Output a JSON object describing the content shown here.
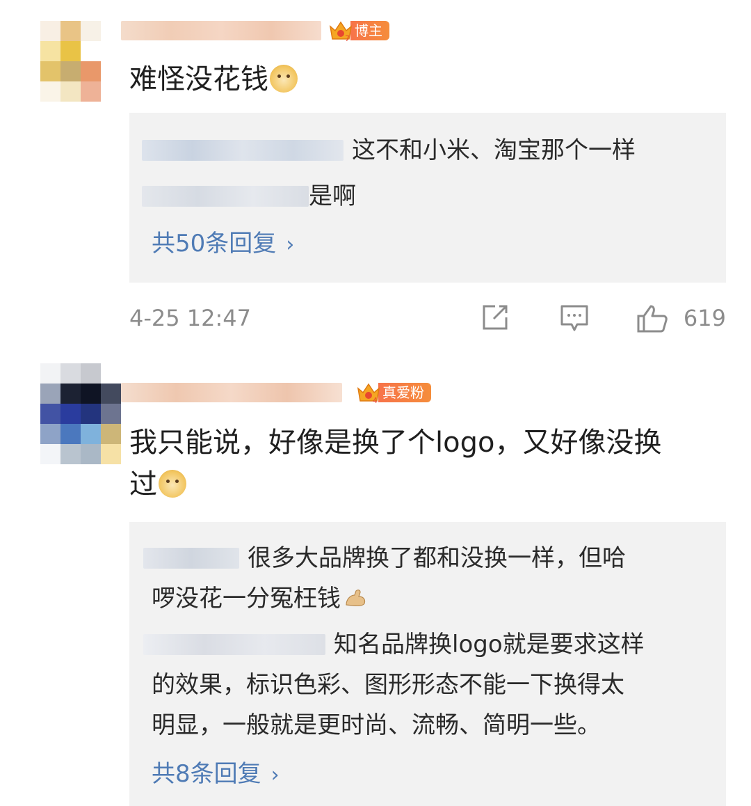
{
  "comments": [
    {
      "badge": "博主",
      "badge_level": "7",
      "text": "难怪没花钱",
      "emoji": "doge-emoji",
      "replies": [
        {
          "text": "这不和小米、淘宝那个一样"
        },
        {
          "text": "是啊"
        }
      ],
      "more_replies": "共50条回复",
      "time": "4-25 12:47",
      "likes": "619",
      "actions": [
        "share-icon",
        "comment-icon",
        "like-icon"
      ]
    },
    {
      "badge": "真爱粉",
      "badge_level": "4",
      "text_line1": "我只能说，好像是换了个logo，又好像没换",
      "text_line2": "过",
      "emoji": "doge-emoji",
      "replies": [
        {
          "line1": "很多大品牌换了都和没换一样，但哈",
          "line2": "啰没花一分冤枉钱",
          "emoji": "flex-arm-emoji"
        },
        {
          "line1": "知名品牌换logo就是要求这样",
          "line2": "的效果，标识色彩、图形形态不能一下换得太",
          "line3": "明显，一般就是更时尚、流畅、简明一些。"
        }
      ],
      "more_replies": "共8条回复"
    }
  ],
  "colors": {
    "link": "#4f7bb5",
    "meta_gray": "#8c8c8c",
    "reply_bg": "#f2f2f2",
    "badge_orange": "#f7734a"
  }
}
